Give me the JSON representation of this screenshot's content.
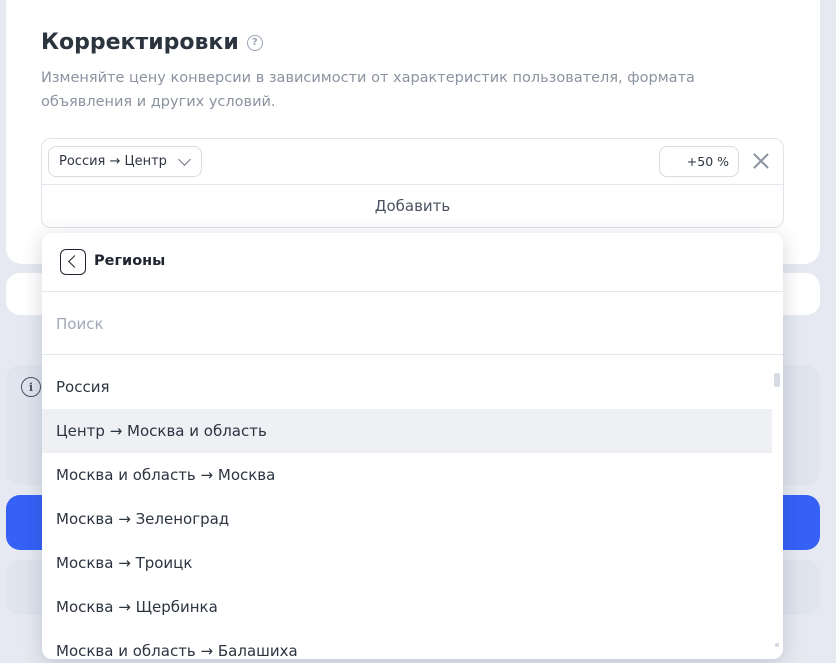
{
  "card": {
    "title": "Корректировки",
    "help_icon_glyph": "?",
    "description": "Изменяйте цену конверсии в зависимости от характеристик пользователя, формата объявления и других условий."
  },
  "adjustment": {
    "region_value": "Россия → Центр",
    "percent_value": "+50 %",
    "add_label": "Добавить"
  },
  "info_icon_glyph": "i",
  "dropdown": {
    "title": "Регионы",
    "search_placeholder": "Поиск",
    "items": [
      "Россия",
      "Центр → Москва и область",
      "Москва и область → Москва",
      "Москва → Зеленоград",
      "Москва → Троицк",
      "Москва → Щербинка",
      "Москва и область → Балашиха"
    ],
    "active_index": 1
  },
  "colors": {
    "primary": "#3561f7",
    "background": "#e6e9f1",
    "active_item": "#eef0f4"
  }
}
